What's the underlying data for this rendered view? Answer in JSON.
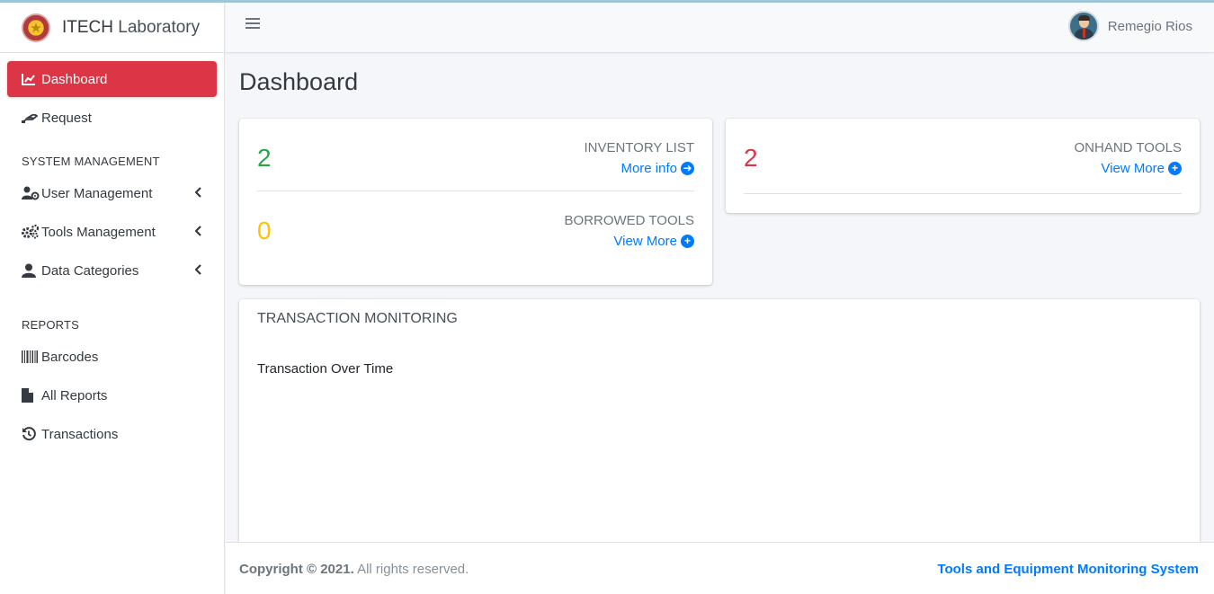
{
  "brand": {
    "name_bold": "ITECH",
    "name_light": "Laboratory"
  },
  "navbar": {
    "user_name": "Remegio Rios"
  },
  "sidebar": {
    "items": [
      {
        "label": "Dashboard",
        "icon": "chart-line-icon"
      },
      {
        "label": "Request",
        "icon": "hand-holding-icon"
      }
    ],
    "section_system": "SYSTEM MANAGEMENT",
    "system_items": [
      {
        "label": "User Management",
        "icon": "users-cog-icon"
      },
      {
        "label": "Tools Management",
        "icon": "cogs-icon"
      },
      {
        "label": "Data Categories",
        "icon": "user-icon"
      }
    ],
    "section_reports": "REPORTS",
    "report_items": [
      {
        "label": "Barcodes",
        "icon": "barcode-icon"
      },
      {
        "label": "All Reports",
        "icon": "file-icon"
      },
      {
        "label": "Transactions",
        "icon": "history-icon"
      }
    ]
  },
  "main": {
    "page_title": "Dashboard",
    "inventory": {
      "value": "2",
      "label": "INVENTORY LIST",
      "link": "More info"
    },
    "borrowed": {
      "value": "0",
      "label": "BORROWED TOOLS",
      "link": "View More"
    },
    "onhand": {
      "value": "2",
      "label": "ONHAND TOOLS",
      "link": "View More"
    },
    "monitoring": {
      "title": "TRANSACTION MONITORING",
      "subtitle": "Transaction Over Time"
    }
  },
  "footer": {
    "copyright": "Copyright © 2021.",
    "rights": "All rights reserved.",
    "system_name": "Tools and Equipment Monitoring System"
  },
  "colors": {
    "active": "#dc3545",
    "link": "#007bff",
    "green": "#28a745",
    "yellow": "#ffc107",
    "red": "#dc3545"
  }
}
